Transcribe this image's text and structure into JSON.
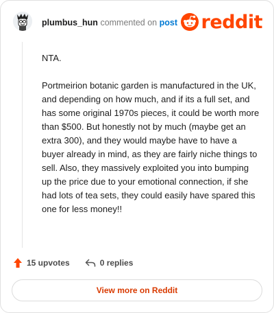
{
  "header": {
    "username": "plumbus_hun",
    "action_text": "commented on",
    "post_link": "post",
    "logo_text": "reddit",
    "avatar_icon": "snoo-avatar-icon",
    "brand_color": "#ff4500"
  },
  "comment": {
    "paragraphs": [
      "NTA.",
      "Portmeirion botanic garden is manufactured in the UK, and depending on how much, and if its a full set, and has some original 1970s pieces, it could be worth more than $500. But honestly not by much (maybe get an extra 300), and they would maybe have to have a buyer already in mind, as they are fairly niche things to sell. Also, they massively exploited you into bumping up the price due to your emotional connection, if she had lots of tea sets, they could easily have spared this one for less money!!"
    ]
  },
  "actions": {
    "upvotes": "15 upvotes",
    "replies": "0 replies",
    "upvote_icon": "upvote-arrow-icon",
    "reply_icon": "reply-arrow-icon"
  },
  "footer": {
    "view_more": "View more on Reddit"
  }
}
